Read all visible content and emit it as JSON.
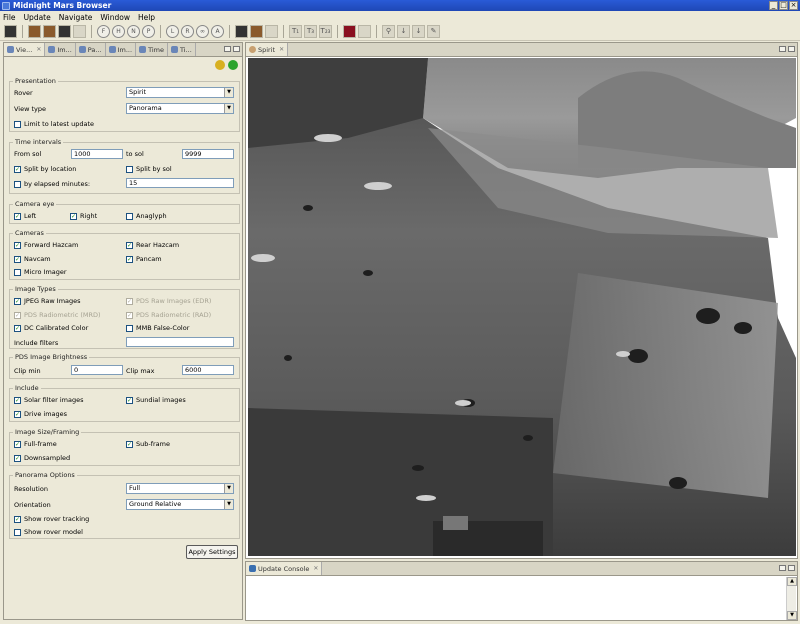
{
  "window": {
    "title": "Midnight Mars Browser"
  },
  "menu": [
    "File",
    "Update",
    "Navigate",
    "Window",
    "Help"
  ],
  "toolbar": {
    "buttons": [
      "F",
      "H",
      "N",
      "P",
      "L",
      "R",
      "A",
      "T₁",
      "T₃",
      "T₂₃"
    ]
  },
  "left_tabs": [
    "Vie...",
    "Im...",
    "Pa...",
    "Im...",
    "Time",
    "Ti..."
  ],
  "presentation": {
    "group": "Presentation",
    "rover_label": "Rover",
    "rover_value": "Spirit",
    "view_type_label": "View type",
    "view_type_value": "Panorama",
    "limit_latest": "Limit to latest update"
  },
  "time": {
    "group": "Time intervals",
    "from_label": "From sol",
    "from_value": "1000",
    "to_label": "to sol",
    "to_value": "9999",
    "split_location": "Split by location",
    "split_sol": "Split by sol",
    "elapsed_label": "by elapsed minutes:",
    "elapsed_value": "15"
  },
  "camera_eye": {
    "group": "Camera eye",
    "left": "Left",
    "right": "Right",
    "anaglyph": "Anaglyph"
  },
  "cameras": {
    "group": "Cameras",
    "forward": "Forward Hazcam",
    "rear": "Rear Hazcam",
    "navcam": "Navcam",
    "pancam": "Pancam",
    "micro": "Micro Imager"
  },
  "image_types": {
    "group": "Image Types",
    "jpeg": "JPEG Raw Images",
    "pds_raw": "PDS Raw Images (EDR)",
    "pds_rad_mrd": "PDS Radiometric (MRD)",
    "pds_rad_rad": "PDS Radiometric (RAD)",
    "dc": "DC Calibrated Color",
    "mmb": "MMB False-Color",
    "include_filters": "Include filters",
    "include_filters_value": ""
  },
  "brightness": {
    "group": "PDS Image Brightness",
    "clip_min_label": "Clip min",
    "clip_min": "0",
    "clip_max_label": "Clip max",
    "clip_max": "6000"
  },
  "include": {
    "group": "Include",
    "solar": "Solar filter images",
    "sundial": "Sundial images",
    "drive": "Drive images"
  },
  "size": {
    "group": "Image Size/Framing",
    "full": "Full-frame",
    "sub": "Sub-frame",
    "down": "Downsampled"
  },
  "panorama": {
    "group": "Panorama Options",
    "resolution_label": "Resolution",
    "resolution_value": "Full",
    "orientation_label": "Orientation",
    "orientation_value": "Ground Relative",
    "tracking": "Show rover tracking",
    "model": "Show rover model"
  },
  "apply_label": "Apply Settings",
  "right_tab": "Spirit",
  "console_tab": "Update Console"
}
